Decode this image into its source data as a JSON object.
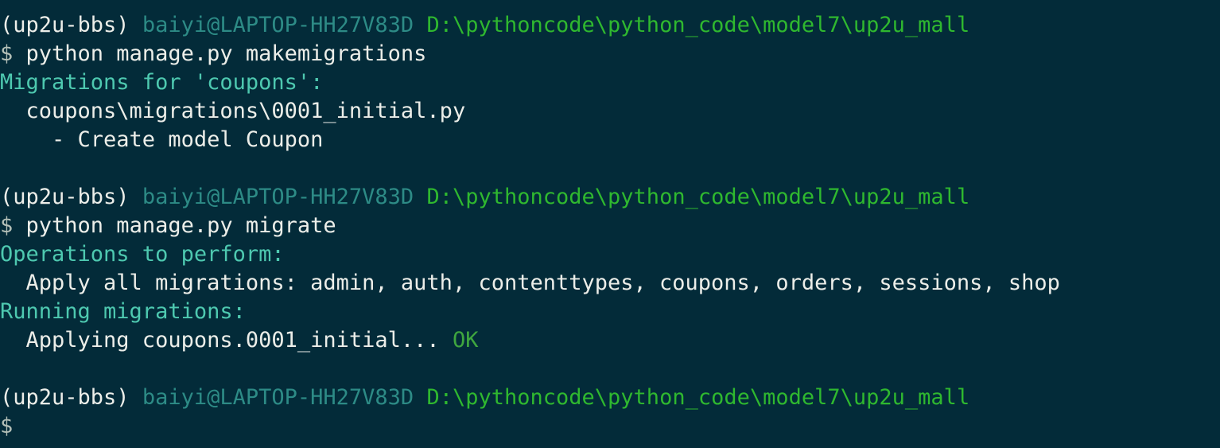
{
  "terminal": {
    "background_color": "#032b39",
    "colors": {
      "venv": "#eceee9",
      "user_host": "#2d8b86",
      "path": "#2fb82f",
      "prompt_symbol": "#b4c0b8",
      "command": "#eceee9",
      "header": "#4ec9b0",
      "body": "#eceee9",
      "ok": "#3fa63f"
    },
    "prompt": {
      "venv": "(up2u-bbs)",
      "user_host": "baiyi@LAPTOP-HH27V83D",
      "path": "D:\\pythoncode\\python_code\\model7\\up2u_mall",
      "symbol": "$"
    },
    "lines": [
      {
        "id": "prompt-line-1",
        "type": "prompt",
        "segments": [
          {
            "role": "venv",
            "text": "(up2u-bbs)"
          },
          {
            "role": "body",
            "text": " "
          },
          {
            "role": "user_host",
            "text": "baiyi@LAPTOP-HH27V83D"
          },
          {
            "role": "body",
            "text": " "
          },
          {
            "role": "path",
            "text": "D:\\pythoncode\\python_code\\model7\\up2u_mall"
          }
        ]
      },
      {
        "id": "command-line-1",
        "type": "command",
        "segments": [
          {
            "role": "prompt_symbol",
            "text": "$"
          },
          {
            "role": "command",
            "text": " python manage.py makemigrations"
          }
        ]
      },
      {
        "id": "output-migrations-for",
        "type": "output",
        "segments": [
          {
            "role": "header",
            "text": "Migrations for 'coupons':"
          }
        ]
      },
      {
        "id": "output-migration-file",
        "type": "output",
        "segments": [
          {
            "role": "body",
            "text": "  coupons\\migrations\\0001_initial.py"
          }
        ]
      },
      {
        "id": "output-create-model",
        "type": "output",
        "segments": [
          {
            "role": "body",
            "text": "    - Create model Coupon"
          }
        ]
      },
      {
        "id": "blank-1",
        "type": "blank",
        "segments": []
      },
      {
        "id": "prompt-line-2",
        "type": "prompt",
        "segments": [
          {
            "role": "venv",
            "text": "(up2u-bbs)"
          },
          {
            "role": "body",
            "text": " "
          },
          {
            "role": "user_host",
            "text": "baiyi@LAPTOP-HH27V83D"
          },
          {
            "role": "body",
            "text": " "
          },
          {
            "role": "path",
            "text": "D:\\pythoncode\\python_code\\model7\\up2u_mall"
          }
        ]
      },
      {
        "id": "command-line-2",
        "type": "command",
        "segments": [
          {
            "role": "prompt_symbol",
            "text": "$"
          },
          {
            "role": "command",
            "text": " python manage.py migrate"
          }
        ]
      },
      {
        "id": "output-operations-to-perform",
        "type": "output",
        "segments": [
          {
            "role": "header",
            "text": "Operations to perform:"
          }
        ]
      },
      {
        "id": "output-apply-all-migrations",
        "type": "output",
        "segments": [
          {
            "role": "body",
            "text": "  Apply all migrations: admin, auth, contenttypes, coupons, orders, sessions, shop"
          }
        ]
      },
      {
        "id": "output-running-migrations",
        "type": "output",
        "segments": [
          {
            "role": "header",
            "text": "Running migrations:"
          }
        ]
      },
      {
        "id": "output-applying-coupons",
        "type": "output",
        "segments": [
          {
            "role": "body",
            "text": "  Applying coupons.0001_initial..."
          },
          {
            "role": "body",
            "text": " "
          },
          {
            "role": "ok",
            "text": "OK"
          }
        ]
      },
      {
        "id": "blank-2",
        "type": "blank",
        "segments": []
      },
      {
        "id": "prompt-line-3",
        "type": "prompt",
        "segments": [
          {
            "role": "venv",
            "text": "(up2u-bbs)"
          },
          {
            "role": "body",
            "text": " "
          },
          {
            "role": "user_host",
            "text": "baiyi@LAPTOP-HH27V83D"
          },
          {
            "role": "body",
            "text": " "
          },
          {
            "role": "path",
            "text": "D:\\pythoncode\\python_code\\model7\\up2u_mall"
          }
        ]
      },
      {
        "id": "command-line-3",
        "type": "command",
        "segments": [
          {
            "role": "prompt_symbol",
            "text": "$"
          }
        ]
      }
    ],
    "migration_summary": {
      "app": "coupons",
      "migration_file": "coupons\\migrations\\0001_initial.py",
      "operation": "- Create model Coupon",
      "applied_apps": [
        "admin",
        "auth",
        "contenttypes",
        "coupons",
        "orders",
        "sessions",
        "shop"
      ],
      "applied_migration": "coupons.0001_initial",
      "result": "OK"
    }
  }
}
